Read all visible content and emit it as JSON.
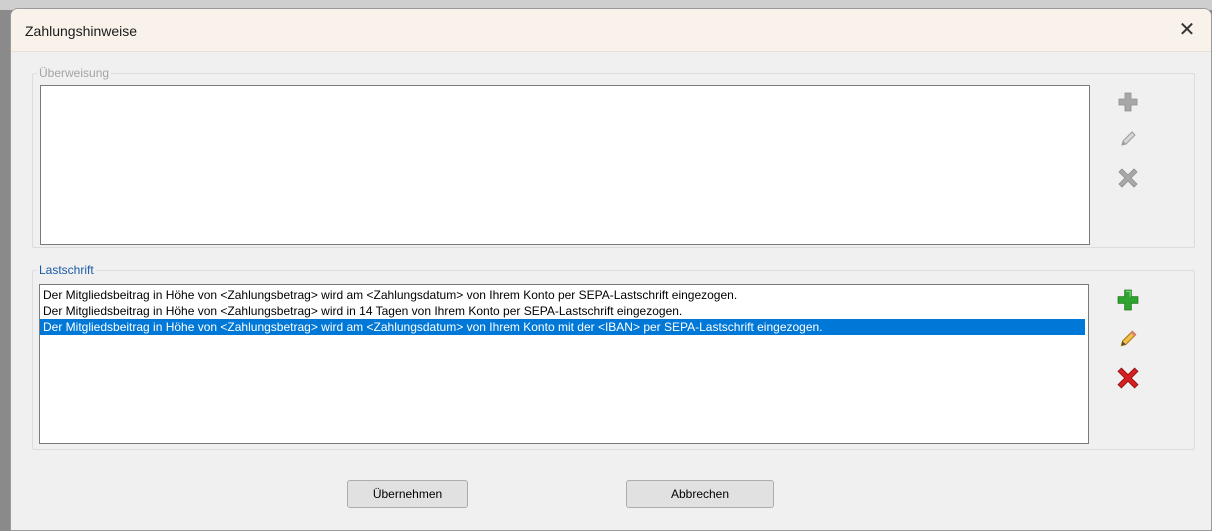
{
  "window": {
    "title": "Zahlungshinweise",
    "close_glyph": "✕"
  },
  "ueberweisung": {
    "legend": "Überweisung",
    "items": [],
    "actions": {
      "add_icon": "plus-icon",
      "edit_icon": "pencil-icon",
      "delete_icon": "x-icon",
      "enabled": false
    }
  },
  "lastschrift": {
    "legend": "Lastschrift",
    "items": [
      {
        "text": "Der Mitgliedsbeitrag in Höhe von <Zahlungsbetrag> wird am <Zahlungsdatum> von Ihrem Konto per SEPA-Lastschrift eingezogen.",
        "selected": false
      },
      {
        "text": "Der Mitgliedsbeitrag in Höhe von <Zahlungsbetrag> wird in 14 Tagen von Ihrem Konto per SEPA-Lastschrift eingezogen.",
        "selected": false
      },
      {
        "text": "Der Mitgliedsbeitrag in Höhe von <Zahlungsbetrag> wird am <Zahlungsdatum> von Ihrem Konto mit der <IBAN> per SEPA-Lastschrift eingezogen.",
        "selected": true
      }
    ],
    "actions": {
      "add_icon": "plus-icon",
      "edit_icon": "pencil-icon",
      "delete_icon": "x-icon",
      "enabled": true
    }
  },
  "buttons": {
    "ok": "Übernehmen",
    "cancel": "Abbrechen"
  },
  "colors": {
    "selection": "#0078d7",
    "add_enabled": "#2fa52f",
    "edit_enabled": "#e0a92a",
    "delete_enabled": "#d42020",
    "disabled": "#a8a8a8"
  }
}
